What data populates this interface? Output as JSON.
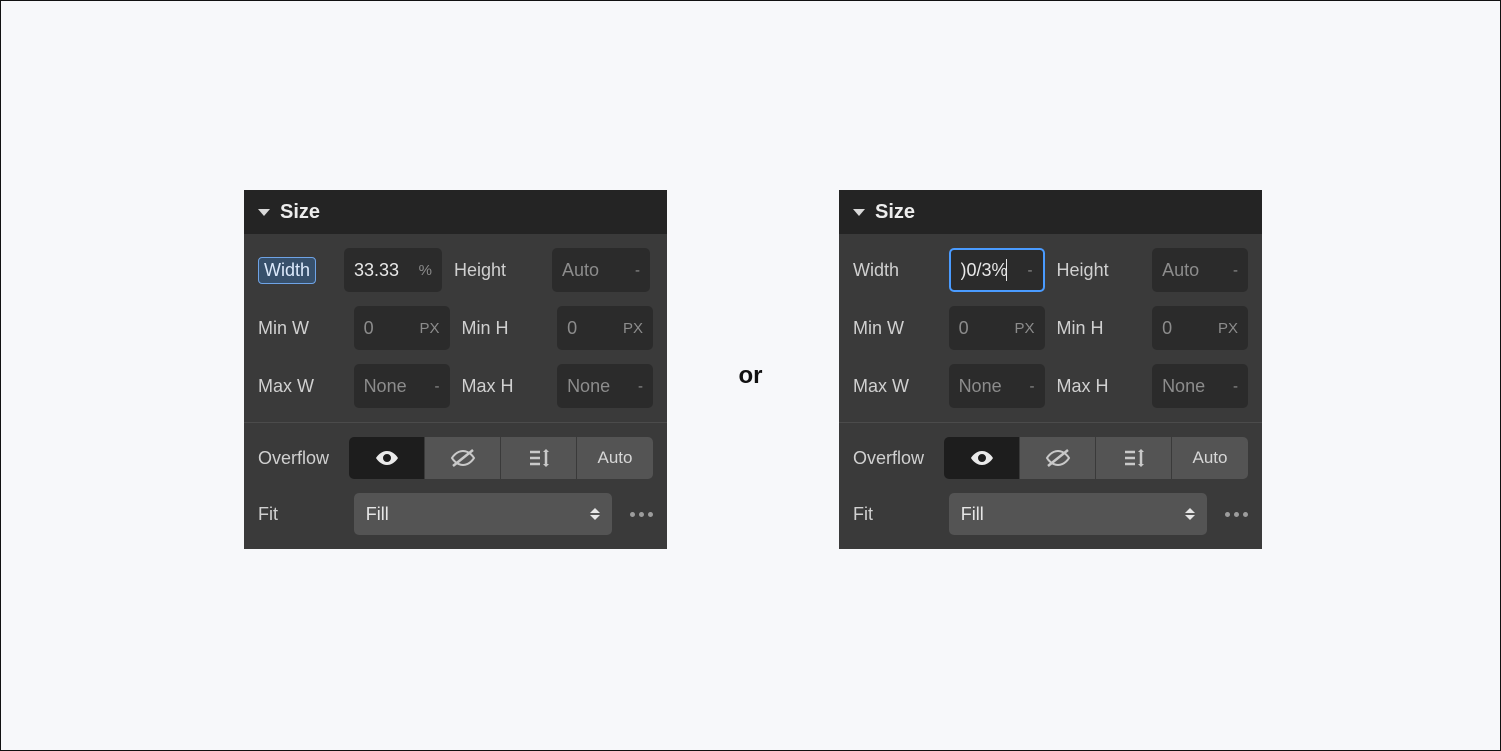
{
  "separator": "or",
  "left": {
    "title": "Size",
    "width_label": "Width",
    "width_value": "33.33",
    "width_unit": "%",
    "height_label": "Height",
    "height_placeholder": "Auto",
    "height_unit": "-",
    "minw_label": "Min W",
    "minw_placeholder": "0",
    "minw_unit": "PX",
    "minh_label": "Min H",
    "minh_placeholder": "0",
    "minh_unit": "PX",
    "maxw_label": "Max W",
    "maxw_placeholder": "None",
    "maxw_unit": "-",
    "maxh_label": "Max H",
    "maxh_placeholder": "None",
    "maxh_unit": "-",
    "overflow_label": "Overflow",
    "overflow_auto": "Auto",
    "fit_label": "Fit",
    "fit_value": "Fill"
  },
  "right": {
    "title": "Size",
    "width_label": "Width",
    "width_value": ")0/3%",
    "width_unit": "-",
    "height_label": "Height",
    "height_placeholder": "Auto",
    "height_unit": "-",
    "minw_label": "Min W",
    "minw_placeholder": "0",
    "minw_unit": "PX",
    "minh_label": "Min H",
    "minh_placeholder": "0",
    "minh_unit": "PX",
    "maxw_label": "Max W",
    "maxw_placeholder": "None",
    "maxw_unit": "-",
    "maxh_label": "Max H",
    "maxh_placeholder": "None",
    "maxh_unit": "-",
    "overflow_label": "Overflow",
    "overflow_auto": "Auto",
    "fit_label": "Fit",
    "fit_value": "Fill"
  }
}
